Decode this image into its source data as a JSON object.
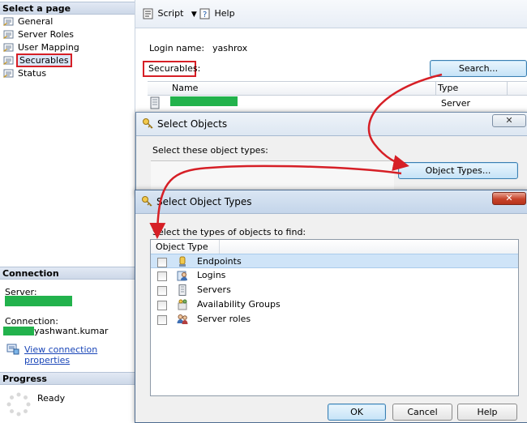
{
  "left_pane": {
    "select_page_header": "Select a page",
    "pages": [
      {
        "label": "General"
      },
      {
        "label": "Server Roles"
      },
      {
        "label": "User Mapping"
      },
      {
        "label": "Securables"
      },
      {
        "label": "Status"
      }
    ],
    "connection_header": "Connection",
    "server_label": "Server:",
    "connection_label": "Connection:",
    "connection_user": "yashwant.kumar",
    "view_connection_link": "View connection properties",
    "progress_header": "Progress",
    "progress_status": "Ready"
  },
  "toolbar": {
    "script_label": "Script",
    "help_label": "Help"
  },
  "login": {
    "name_label": "Login name:",
    "name_value": "yashrox",
    "securables_label": "Securables:",
    "search_button": "Search...",
    "grid_columns": [
      "Name",
      "Type"
    ],
    "grid_rows": [
      {
        "type": "Server"
      }
    ]
  },
  "select_objects_dialog": {
    "title": "Select Objects",
    "object_types_label": "Select these object types:",
    "object_types_button": "Object Types..."
  },
  "select_object_types_dialog": {
    "title": "Select Object Types",
    "instruction": "Select the types of objects to find:",
    "column_header": "Object Type",
    "items": [
      {
        "label": "Endpoints",
        "icon": "endpoint-icon"
      },
      {
        "label": "Logins",
        "icon": "login-icon"
      },
      {
        "label": "Servers",
        "icon": "server-icon"
      },
      {
        "label": "Availability Groups",
        "icon": "availability-group-icon"
      },
      {
        "label": "Server roles",
        "icon": "server-role-icon"
      }
    ],
    "ok_button": "OK",
    "cancel_button": "Cancel",
    "help_button": "Help"
  },
  "colors": {
    "highlight_red": "#d61f26",
    "redacted_green": "#22b24c",
    "link_blue": "#1a46b8"
  }
}
